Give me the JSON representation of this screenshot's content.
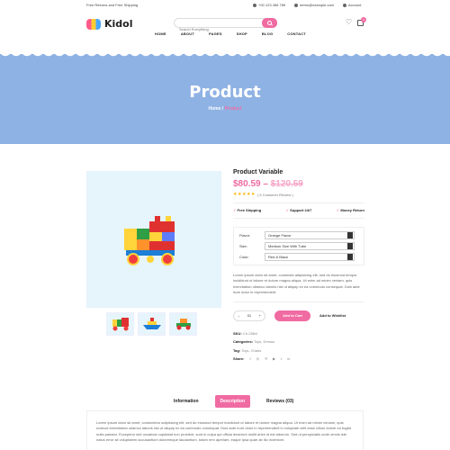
{
  "topbar": {
    "promo": "Free Returns and Free Shipping",
    "phone": "+00 123 456 789",
    "email": "demo@example.com",
    "account": "Account"
  },
  "header": {
    "logo": "Kidol",
    "search_placeholder": "Search Everything",
    "cart_count": "0",
    "nav": [
      "HOME",
      "ABOUT",
      "PAGES",
      "SHOP",
      "BLOG",
      "CONTACT"
    ]
  },
  "banner": {
    "title": "Product",
    "breadcrumb_home": "Home",
    "breadcrumb_sep": " / ",
    "breadcrumb_current": "Product"
  },
  "product": {
    "title": "Product Variable",
    "price": "$80.59",
    "price_sep": " – ",
    "old_price": "$120.59",
    "stars": "★★★★★",
    "rating_count": 5,
    "reviews": "( 5 Customer Review )",
    "features": [
      "Free Shipping",
      "Support 24/7",
      "Money Return"
    ],
    "options": [
      {
        "label": "Flavor:",
        "value": "Orange Flavor"
      },
      {
        "label": "Size:",
        "value": "Medium Size With Tube"
      },
      {
        "label": "Color:",
        "value": "Red & Black"
      }
    ],
    "description": "Lorem ipsum dolor sit amet, consectet adipisicing elit, sed do eiusmod tempor incididunt ut labore et dolore magna aliqua. Ut enim ad minim veniam, quis exercitation ullamco laboris nisi ut aliquip ex ea commodo consequat. Duis aute irure dolor in reprehenderit.",
    "qty_minus": "–",
    "qty": "01",
    "qty_plus": "+",
    "add_to_cart": "Add to Cart",
    "add_to_wishlist": "Add to Wishlist",
    "sku_label": "SKU:",
    "sku": "Ch-256xl",
    "categories_label": "Categories:",
    "categories": "Toys, Dresss",
    "tag_label": "Tag:",
    "tag": "Toys, Chairs",
    "share_label": "Share:"
  },
  "tabs": {
    "items": [
      "Information",
      "Description",
      "Reviews (03)"
    ],
    "active": "Description",
    "panel_text": "Lorem ipsum dolor sit amet, consectetur adipisicing elit, sed do eiusmod tempor incididunt ut labore et dolore magna aliqua. Ut enim ad minim veniam, quis nostrud exercitation ullamco laboris nisi ut aliquip ex ea commodo consequat. Duis aute irure dolor in reprehenderit in voluptate velit esse cillum dolore eu fugiat nulla pariatur. Excepteur sint occaecat cupidatat non proident, sunt in culpa qui officia deserunt mollit anim id est laborum. Sed ut perspiciatis unde omnis iste natus error sit voluptatem accusantium doloremque laudantium, totam rem aperiam, eaque ipsa quae ab illo inventore."
  },
  "colors": {
    "accent": "#f06ba2",
    "banner": "#8fb2e4",
    "image_bg": "#e6f4fb"
  }
}
